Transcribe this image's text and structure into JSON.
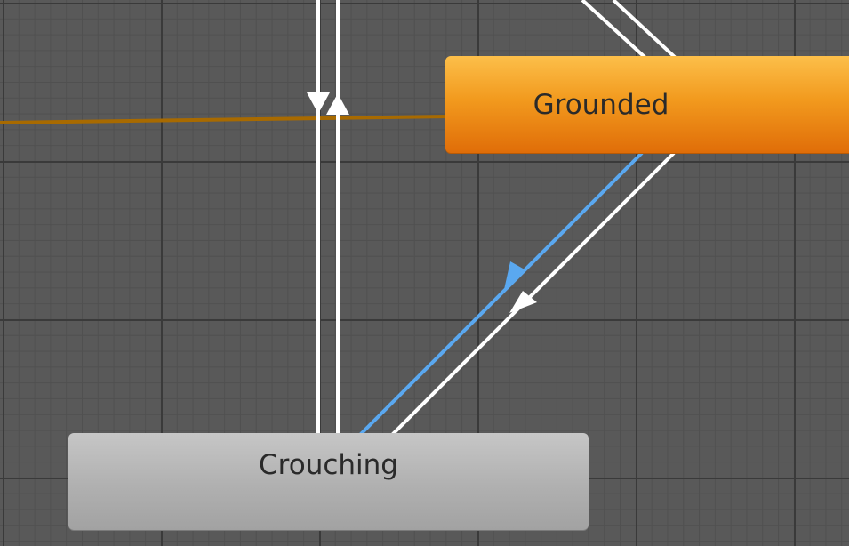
{
  "graph": {
    "colors": {
      "background": "#595959",
      "transition": "#ffffff",
      "selected_transition": "#5aa8f0",
      "entry_line": "#a86a00",
      "grounded_node": "#f29a1e",
      "crouching_node": "#b0b0b0"
    },
    "states": [
      {
        "id": "grounded",
        "label": "Grounded",
        "kind": "default-state"
      },
      {
        "id": "crouching",
        "label": "Crouching",
        "kind": "state"
      }
    ],
    "transitions": [
      {
        "from": "grounded",
        "to": "crouching",
        "selected": true
      },
      {
        "from": "crouching",
        "to": "grounded",
        "selected": false
      },
      {
        "from": "offscreen-top",
        "to": "offscreen-bottom",
        "selected": false
      },
      {
        "from": "offscreen-bottom",
        "to": "offscreen-top",
        "selected": false
      }
    ]
  }
}
